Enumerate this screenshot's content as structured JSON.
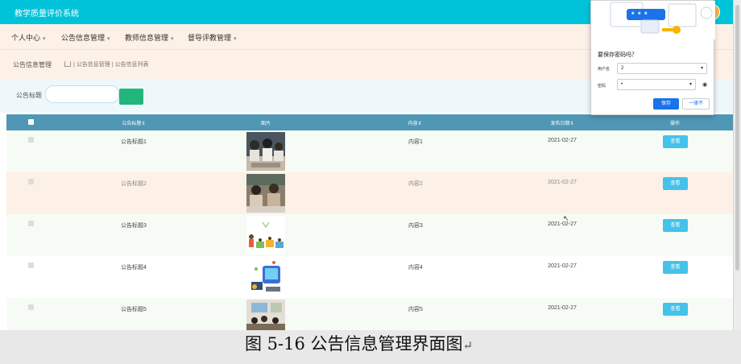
{
  "app": {
    "title": "教学质量评价系统"
  },
  "nav": {
    "items": [
      {
        "label": "个人中心"
      },
      {
        "label": "公告信息管理"
      },
      {
        "label": "教师信息管理"
      },
      {
        "label": "督导评教管理"
      }
    ]
  },
  "page": {
    "name": "公告信息管理",
    "breadcrumb": "| 公告信息管理 | 公告信息列表"
  },
  "search": {
    "label": "公告标题",
    "placeholder": "",
    "value": "",
    "button_label": ""
  },
  "table": {
    "columns": [
      "公告标题",
      "图片",
      "内容",
      "发布日期",
      "操作"
    ],
    "rows": [
      {
        "title": "公告标题1",
        "content": "内容1",
        "date": "2021-02-27",
        "action": "查看"
      },
      {
        "title": "公告标题2",
        "content": "内容2",
        "date": "2021-02-27",
        "action": "查看"
      },
      {
        "title": "公告标题3",
        "content": "内容3",
        "date": "2021-02-27",
        "action": "查看"
      },
      {
        "title": "公告标题4",
        "content": "内容4",
        "date": "2021-02-27",
        "action": "查看"
      },
      {
        "title": "公告标题5",
        "content": "内容5",
        "date": "2021-02-27",
        "action": "查看"
      }
    ]
  },
  "password_popup": {
    "question": "要保存密码吗？",
    "username_label": "用户名",
    "username_value": "2",
    "password_label": "密码",
    "password_value": "•",
    "stars": "* * *",
    "save_label": "保存",
    "never_label": "一律不"
  },
  "caption": {
    "text": "图 5-16 公告信息管理界面图"
  },
  "colors": {
    "topbar": "#00c2d9",
    "nav_bg": "#fdf0e6",
    "table_header": "#4f97b5",
    "search_button": "#21b67c",
    "view_button": "#44c2ea",
    "save_button": "#1a73e8"
  }
}
